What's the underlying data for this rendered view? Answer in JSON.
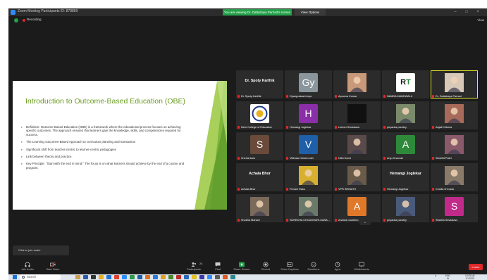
{
  "window": {
    "title": "Zoom Meeting Participants ID: 878869",
    "viewing_banner": "You are viewing Dr. Dattatraya Parhad's screen",
    "view_options": "View Options",
    "min": "–",
    "max": "□",
    "close": "×"
  },
  "meeting": {
    "recording_label": "Recording",
    "view_label": "View"
  },
  "slide": {
    "title": "Introduction to Outcome-Based Education (OBE)",
    "bullets": [
      "Definition: Outcome-Based Education (OBE) is a framework where the educational process focuses on achieving specific outcomes. The approach ensures that learners gain the knowledge, skills, and competencies required for success.",
      "The Learning outcomes-Based Approach to curriculum planning and transaction",
      "Significant shift from teacher-centric to learner-centric pedagogies",
      "Link between theory and practice.",
      "Key Principle: \"Start with the end in mind.\" The focus is on what learners should achieve by the end of a course and program."
    ]
  },
  "participants": [
    {
      "name": "Dr. Spoty Karthik",
      "big": "Dr. Spoty Karthik"
    },
    {
      "name": "Gyanprakash Arya",
      "initials": "Gy",
      "color": "#8a969c"
    },
    {
      "name": "Apoorva Kumar",
      "photo": "#c89a7a"
    },
    {
      "name": "NAMDA MANDWALA",
      "logo": "RT"
    },
    {
      "name": "Dr. Dattatraya Parhad",
      "photo": "#d8c8b8",
      "active": true
    },
    {
      "name": "Nehr College of Education",
      "logo": "emblem"
    },
    {
      "name": "Hemangi Joglekar",
      "initials": "H",
      "color": "#8b2fa8"
    },
    {
      "name": "Lohom Srivastava",
      "photo": "#111111"
    },
    {
      "name": "priyanka pandey",
      "photo": "#7a8a6a"
    },
    {
      "name": "Anjali Kirtonia",
      "photo": "#a86a5a"
    },
    {
      "name": "Snehal kalu",
      "initials": "S",
      "color": "#6a4a3a"
    },
    {
      "name": "Vidhwan Deshmukh",
      "initials": "V",
      "color": "#1e5fa8"
    },
    {
      "name": "Nitin Kochi",
      "photo": "#5a4a4a"
    },
    {
      "name": "Anju Chaurah",
      "initials": "A",
      "color": "#2e8a3a"
    },
    {
      "name": "Shobhit Patel",
      "photo": "#8a5a6a"
    },
    {
      "name": "Achala Bhor",
      "big": "Achala Bhor"
    },
    {
      "name": "Ponam Raku",
      "photo": "#d8b030"
    },
    {
      "name": "VPR SRINATH",
      "photo": "#6a5a4a"
    },
    {
      "name": "Hemangi Joglekar",
      "big": "Hemangi Joglekar"
    },
    {
      "name": "Cecilia D'Costa",
      "photo": "#8a7a6a"
    },
    {
      "name": "Shubha Mohare",
      "photo": "#7a6a5a"
    },
    {
      "name": "SUREKHA CHOUDHARI-KANA...",
      "photo": "#6a7a6a"
    },
    {
      "name": "Andrea Coutinho",
      "initials": "A",
      "color": "#e0782a"
    },
    {
      "name": "priyanka pandey",
      "photo": "#4a5a7a"
    },
    {
      "name": "Shweta Srivastava",
      "initials": "S",
      "color": "#c22a8a"
    }
  ],
  "join_audio": "Click to join audio",
  "toolbar": {
    "buttons": [
      {
        "label": "Join Audio",
        "icon": "headphones-icon"
      },
      {
        "label": "Start Video",
        "icon": "video-off-icon"
      },
      {
        "label": "Participants",
        "icon": "participants-icon"
      },
      {
        "label": "Chat",
        "icon": "chat-icon"
      },
      {
        "label": "Share Screen",
        "icon": "share-screen-icon"
      },
      {
        "label": "Record",
        "icon": "record-icon"
      },
      {
        "label": "Show Captions",
        "icon": "captions-icon"
      },
      {
        "label": "Reactions",
        "icon": "reactions-icon"
      },
      {
        "label": "Apps",
        "icon": "apps-icon"
      },
      {
        "label": "Whiteboards",
        "icon": "whiteboard-icon"
      }
    ],
    "end_label": "Leave",
    "participants_count": "24"
  },
  "taskbar": {
    "search_placeholder": "Search",
    "lang": "ENG\nIN",
    "clock": "10:05 AM\n1/1/2025",
    "chevron": "^"
  },
  "colors": {
    "zoom_blue": "#2d8cff",
    "banner_green": "#23a049",
    "slide_green": "#6a9c1f",
    "end_red": "#e02828",
    "active_outline": "#e8e82a"
  }
}
